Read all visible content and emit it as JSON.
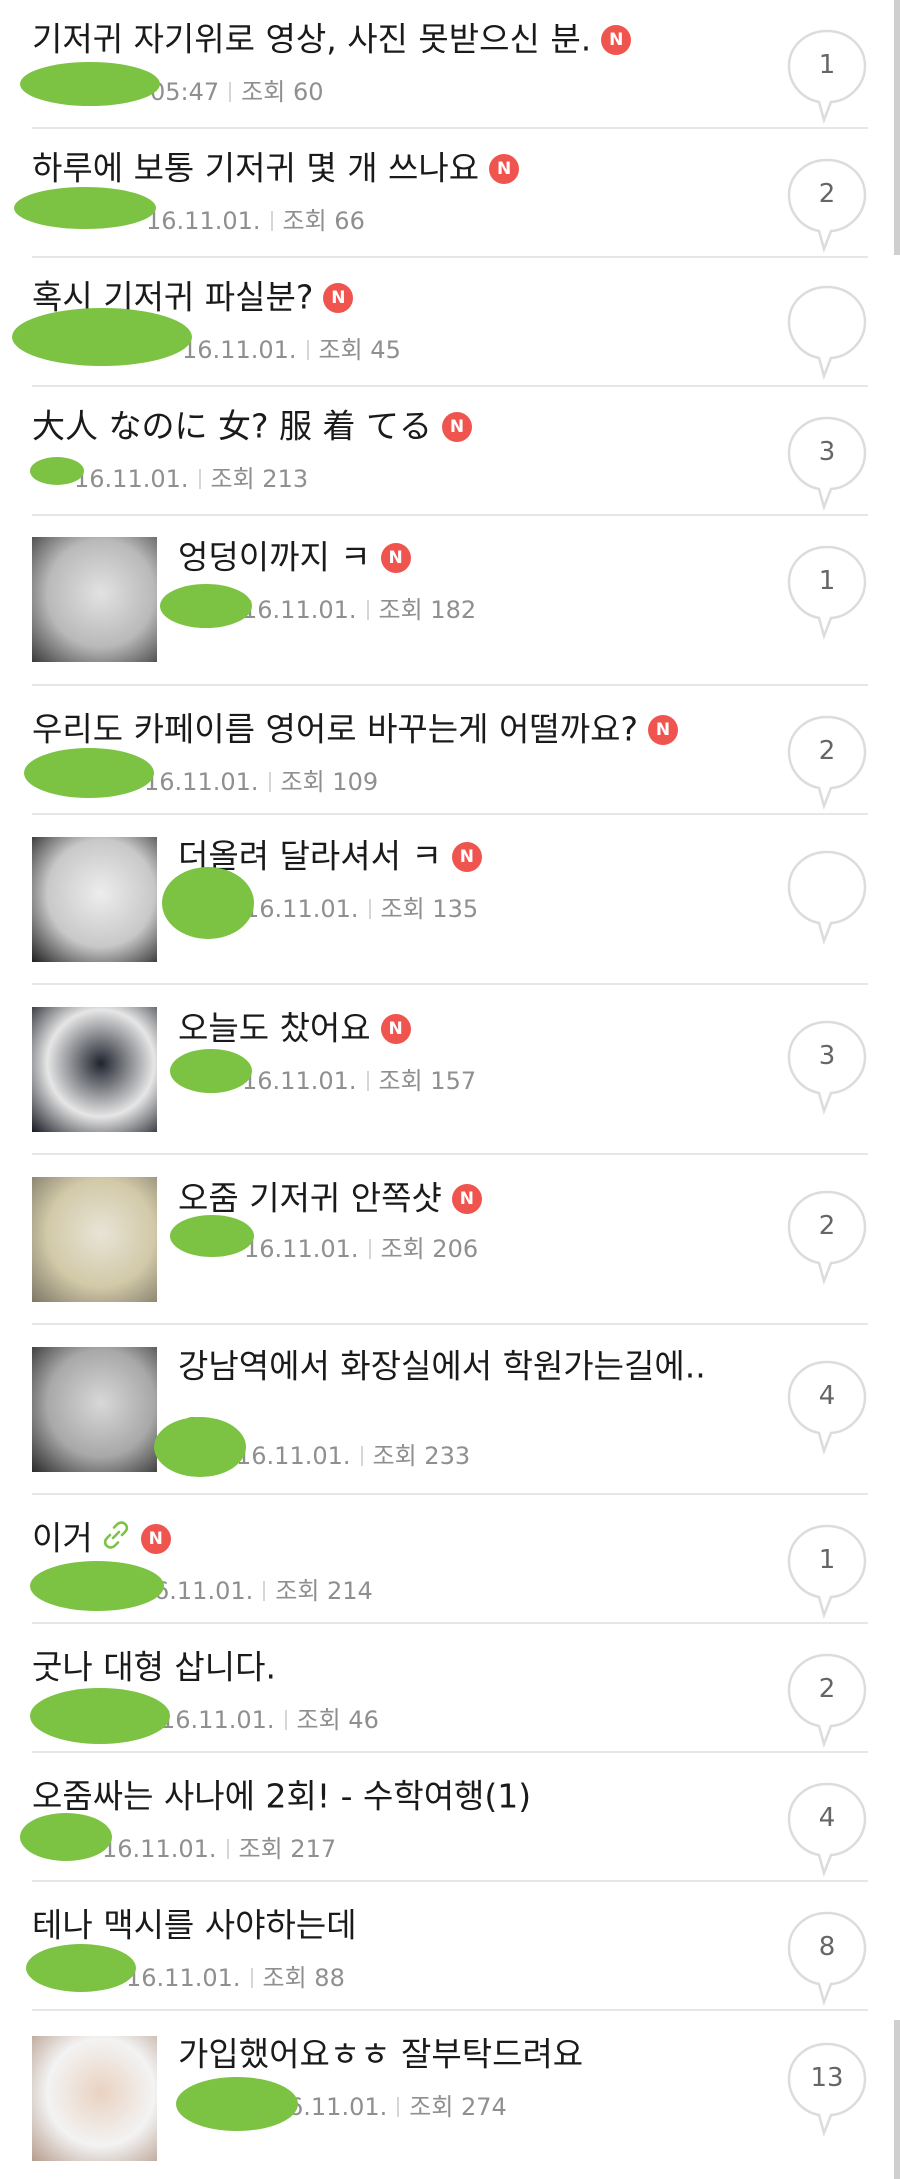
{
  "accent_color": "#f0544f",
  "posts": [
    {
      "title": "기저귀 자기위로 영상, 사진 못받으신 분.",
      "new_badge": "N",
      "date": "05:47",
      "views": "조회 60",
      "comments": "1",
      "thumb": null
    },
    {
      "title": "하루에 보통 기저귀 몇 개 쓰나요",
      "new_badge": "N",
      "date": "16.11.01.",
      "views": "조회 66",
      "comments": "2",
      "thumb": null
    },
    {
      "title": "혹시 기저귀 파실분?",
      "new_badge": "N",
      "date": "16.11.01.",
      "views": "조회 45",
      "comments": "",
      "thumb": null
    },
    {
      "title": "大人 なのに 女? 服 着 てる",
      "new_badge": "N",
      "date": "16.11.01.",
      "views": "조회 213",
      "comments": "3",
      "thumb": null
    },
    {
      "title": "엉덩이까지 ㅋ",
      "new_badge": "N",
      "date": "16.11.01.",
      "views": "조회 182",
      "comments": "1",
      "thumb": "photo"
    },
    {
      "title": "우리도 카페이름 영어로 바꾸는게 어떨까요?",
      "new_badge": "N",
      "date": "16.11.01.",
      "views": "조회 109",
      "comments": "2",
      "thumb": null
    },
    {
      "title": "더올려 달라셔서 ㅋ",
      "new_badge": "N",
      "date": "16.11.01.",
      "views": "조회 135",
      "comments": "",
      "thumb": "photo"
    },
    {
      "title": "오늘도 찼어요",
      "new_badge": "N",
      "date": "16.11.01.",
      "views": "조회 157",
      "comments": "3",
      "thumb": "photo"
    },
    {
      "title": "오줌 기저귀 안쪽샷",
      "new_badge": "N",
      "date": "16.11.01.",
      "views": "조회 206",
      "comments": "2",
      "thumb": "photo"
    },
    {
      "title": "강남역에서 화장실에서 학원가는길에..",
      "new_badge": "N",
      "date": "16.11.01.",
      "views": "조회 233",
      "comments": "4",
      "thumb": "photo"
    },
    {
      "title": "이거",
      "new_badge": "N",
      "date": "6.11.01.",
      "views": "조회 214",
      "comments": "1",
      "thumb": null,
      "link_icon": "link-icon"
    },
    {
      "title": "굿나 대형 삽니다.",
      "new_badge": "",
      "date": "16.11.01.",
      "views": "조회 46",
      "comments": "2",
      "thumb": null
    },
    {
      "title": "오줌싸는 사나에 2회! - 수학여행(1)",
      "new_badge": "",
      "date": "16.11.01.",
      "views": "조회 217",
      "comments": "4",
      "thumb": null
    },
    {
      "title": "테나 맥시를 사야하는데",
      "new_badge": "",
      "date": "16.11.01.",
      "views": "조회 88",
      "comments": "8",
      "thumb": null
    },
    {
      "title": "가입했어요ㅎㅎ 잘부탁드려요",
      "new_badge": "",
      "date": "6.11.01.",
      "views": "조회 274",
      "comments": "13",
      "thumb": "photo"
    }
  ]
}
